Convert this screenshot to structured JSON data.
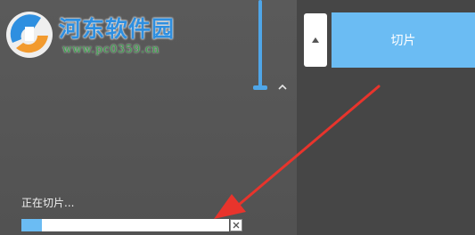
{
  "watermark": {
    "site_name": "河东软件园",
    "url": "www.pc0359.cn"
  },
  "toolbar": {
    "cut_label": "切片",
    "sort_icon": "caret-up-icon"
  },
  "status": {
    "text": "正在切片..."
  },
  "progress": {
    "fraction": 0.1
  },
  "icons": {
    "collapse": "chevron-up-icon",
    "cancel": "close-icon"
  },
  "colors": {
    "accent": "#6bbcf3",
    "slider": "#4fa6e8",
    "annotation_arrow": "#e8342c"
  }
}
